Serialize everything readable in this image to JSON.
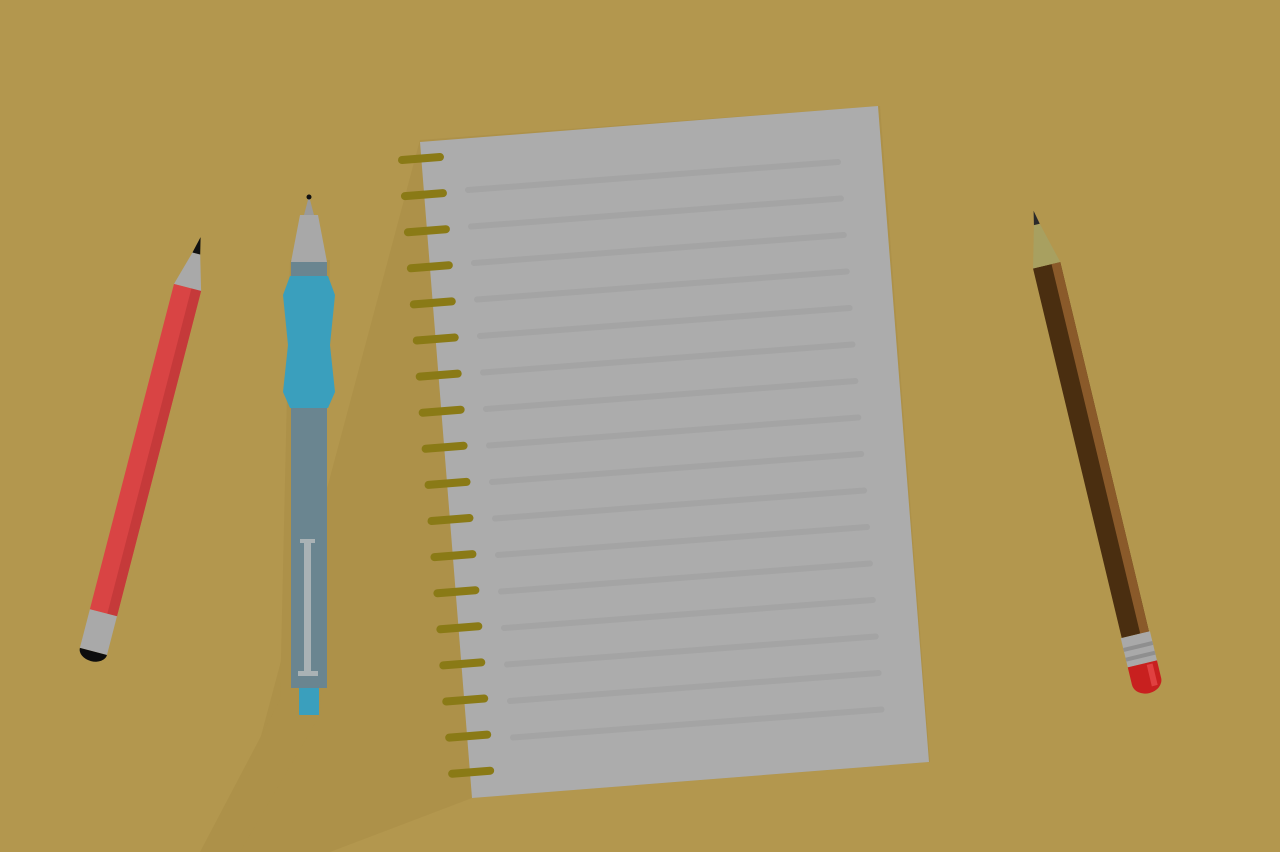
{
  "scene": {
    "background_color": "#b3974e",
    "shadow_color": "#a98d45",
    "items": [
      {
        "name": "red-pencil",
        "kind": "pencil",
        "body_color": "#d94444"
      },
      {
        "name": "blue-pen",
        "kind": "pen",
        "grip_color": "#3a9fbd",
        "barrel_color": "#6a8590"
      },
      {
        "name": "spiral-notebook",
        "kind": "notebook",
        "page_color": "#ababab",
        "ring_color": "#8a7a16",
        "ring_count": 18,
        "line_count": 16
      },
      {
        "name": "brown-pencil",
        "kind": "pencil",
        "body_color": "#4a2e10",
        "eraser_color": "#c8201f"
      }
    ]
  }
}
